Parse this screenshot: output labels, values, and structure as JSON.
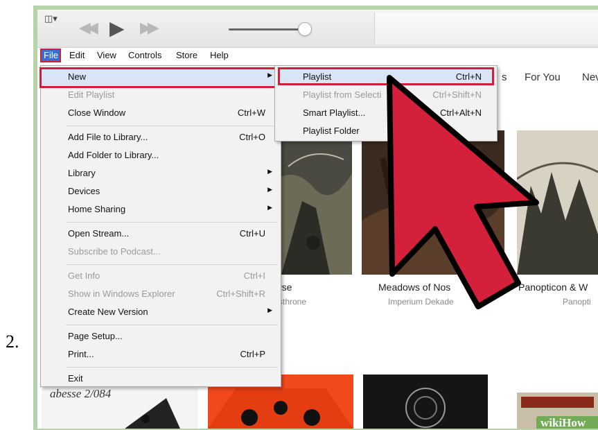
{
  "step_number": "2.",
  "menubar": {
    "items": [
      "File",
      "Edit",
      "View",
      "Controls",
      "Store",
      "Help"
    ]
  },
  "tabs": {
    "partial": "s",
    "for_you": "For You",
    "next": "Nev"
  },
  "file_menu": {
    "groups": [
      [
        {
          "label": "New",
          "shortcut": "",
          "submenu": true,
          "disabled": false
        },
        {
          "label": "Edit Playlist",
          "shortcut": "",
          "submenu": false,
          "disabled": true
        },
        {
          "label": "Close Window",
          "shortcut": "Ctrl+W",
          "submenu": false,
          "disabled": false
        }
      ],
      [
        {
          "label": "Add File to Library...",
          "shortcut": "Ctrl+O",
          "submenu": false,
          "disabled": false
        },
        {
          "label": "Add Folder to Library...",
          "shortcut": "",
          "submenu": false,
          "disabled": false
        },
        {
          "label": "Library",
          "shortcut": "",
          "submenu": true,
          "disabled": false
        },
        {
          "label": "Devices",
          "shortcut": "",
          "submenu": true,
          "disabled": false
        },
        {
          "label": "Home Sharing",
          "shortcut": "",
          "submenu": true,
          "disabled": false
        }
      ],
      [
        {
          "label": "Open Stream...",
          "shortcut": "Ctrl+U",
          "submenu": false,
          "disabled": false
        },
        {
          "label": "Subscribe to Podcast...",
          "shortcut": "",
          "submenu": false,
          "disabled": true
        }
      ],
      [
        {
          "label": "Get Info",
          "shortcut": "Ctrl+I",
          "submenu": false,
          "disabled": true
        },
        {
          "label": "Show in Windows Explorer",
          "shortcut": "Ctrl+Shift+R",
          "submenu": false,
          "disabled": true
        },
        {
          "label": "Create New Version",
          "shortcut": "",
          "submenu": true,
          "disabled": false
        }
      ],
      [
        {
          "label": "Page Setup...",
          "shortcut": "",
          "submenu": false,
          "disabled": false
        },
        {
          "label": "Print...",
          "shortcut": "Ctrl+P",
          "submenu": false,
          "disabled": false
        }
      ],
      [
        {
          "label": "Exit",
          "shortcut": "",
          "submenu": false,
          "disabled": false
        }
      ]
    ]
  },
  "new_submenu": [
    {
      "label": "Playlist",
      "shortcut": "Ctrl+N",
      "disabled": false
    },
    {
      "label": "Playlist from Selecti",
      "shortcut": "Ctrl+Shift+N",
      "disabled": true
    },
    {
      "label": "Smart Playlist...",
      "shortcut": "Ctrl+Alt+N",
      "disabled": false
    },
    {
      "label": "Playlist Folder",
      "shortcut": "",
      "disabled": false
    }
  ],
  "albums": [
    {
      "title": "rse",
      "artist": "sthrone"
    },
    {
      "title": "Meadows of Nos",
      "artist": "Imperium Dekade"
    },
    {
      "title": "Panopticon & W",
      "artist": "Panopti"
    }
  ],
  "cover_text": {
    "bottom_left": "abesse 2/084"
  },
  "watermark": "wikiHow",
  "colors": {
    "highlight_red": "#d11f3a",
    "menu_bg": "#f2f2f2",
    "frame_green": "#b6d4a8",
    "selected_blue": "#3a6fd1"
  }
}
